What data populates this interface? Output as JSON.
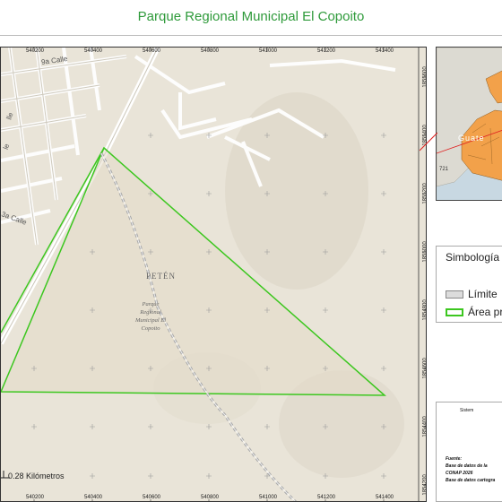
{
  "title": "Parque Regional Municipal El Copoito",
  "grid_x_labels": [
    "540200",
    "540400",
    "540600",
    "540800",
    "541000",
    "541200",
    "541400"
  ],
  "grid_y_labels": [
    "1855600",
    "1855400",
    "1855200",
    "1855000",
    "1854800",
    "1854600",
    "1854400",
    "1854200"
  ],
  "map_labels": {
    "street_9a": "9a Calle",
    "street_3a": "3a Calle",
    "street_frag_1": "lle",
    "street_frag_2": "le",
    "region": "PETÉN",
    "park_line1": "Parque",
    "park_line2": "Regional",
    "park_line3": "Municipal El",
    "park_line4": "Copoito"
  },
  "scale": {
    "label": "0.28 Kilómetros"
  },
  "inset": {
    "label": "Guate",
    "number": "721"
  },
  "legend": {
    "title": "Simbología",
    "items": [
      {
        "label": "Límite",
        "color": "#dcdcdc",
        "border": "#888888"
      },
      {
        "label": "Área pr",
        "color": "#ffffff",
        "border": "#3cc71f"
      }
    ]
  },
  "info": {
    "heading": "Sistem",
    "source_label": "Fuente:",
    "source_line1": "Base de datos de la",
    "source_line2": "CONAP 2026",
    "source_line3": "Base de datos cartogra"
  },
  "colors": {
    "title": "#2e9a3a",
    "protected_area": "#3cc71f",
    "inset_country": "#f2a14a",
    "inset_line": "#e02020"
  }
}
